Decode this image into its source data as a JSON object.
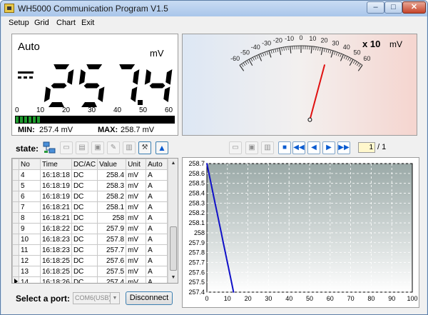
{
  "window": {
    "title": "WH5000 Communication Program V1.5",
    "controls": {
      "minimize": "–",
      "maximize": "□",
      "close": "✕"
    }
  },
  "menu": {
    "items": [
      "Setup",
      "Grid",
      "Chart",
      "Exit"
    ],
    "mnemonics": [
      "S",
      "G",
      "h",
      "E"
    ]
  },
  "display": {
    "mode": "Auto",
    "unit": "mV",
    "reading": "257.4",
    "coupling_icon": "dc-icon",
    "bargraph_ticks": [
      "0",
      "10",
      "20",
      "30",
      "40",
      "50",
      "60"
    ],
    "bargraph_fraction": 0.158,
    "min_label": "MIN:",
    "min_value": "257.4  mV",
    "max_label": "MAX:",
    "max_value": "258.7  mV"
  },
  "gauge": {
    "multiplier": "x 10",
    "unit": "mV",
    "scale_labels": [
      "-60",
      "-50",
      "-40",
      "-30",
      "-20",
      "-10",
      "0",
      "10",
      "20",
      "30",
      "40",
      "50",
      "60"
    ],
    "needle_value": 25.74,
    "needle_color": "#e01010"
  },
  "state": {
    "label": "state:",
    "icons": [
      "network-icon",
      "new-icon",
      "open-icon",
      "save-icon",
      "clear-icon",
      "print-icon",
      "tools-icon",
      "upload-icon"
    ]
  },
  "table": {
    "columns": [
      "No",
      "Time",
      "DC/AC",
      "Value",
      "Unit",
      "Auto"
    ],
    "rows": [
      [
        "4",
        "16:18:18",
        "DC",
        "258.4",
        "mV",
        "A"
      ],
      [
        "5",
        "16:18:19",
        "DC",
        "258.3",
        "mV",
        "A"
      ],
      [
        "6",
        "16:18:19",
        "DC",
        "258.2",
        "mV",
        "A"
      ],
      [
        "7",
        "16:18:21",
        "DC",
        "258.1",
        "mV",
        "A"
      ],
      [
        "8",
        "16:18:21",
        "DC",
        "258",
        "mV",
        "A"
      ],
      [
        "9",
        "16:18:22",
        "DC",
        "257.9",
        "mV",
        "A"
      ],
      [
        "10",
        "16:18:23",
        "DC",
        "257.8",
        "mV",
        "A"
      ],
      [
        "11",
        "16:18:23",
        "DC",
        "257.7",
        "mV",
        "A"
      ],
      [
        "12",
        "16:18:25",
        "DC",
        "257.6",
        "mV",
        "A"
      ],
      [
        "13",
        "16:18:25",
        "DC",
        "257.5",
        "mV",
        "A"
      ],
      [
        "14",
        "16:18:26",
        "DC",
        "257.4",
        "mV",
        "A"
      ]
    ],
    "current_row": 10
  },
  "port": {
    "label": "Select a port:",
    "selected": "COM6(USB)",
    "button_label": "Disconnect"
  },
  "chart_toolbar": {
    "icons": [
      "new-icon",
      "save-icon",
      "print-icon",
      "stop-icon",
      "first-icon",
      "prev-icon",
      "next-icon",
      "last-icon"
    ],
    "page_current": "1",
    "page_total": "/ 1"
  },
  "chart_data": {
    "type": "line",
    "title": "",
    "xlabel": "",
    "ylabel": "",
    "x": [
      0,
      1,
      2,
      3,
      4,
      5,
      6,
      7,
      8,
      9,
      10,
      11,
      12,
      13
    ],
    "series": [
      {
        "values": [
          258.7,
          258.6,
          258.5,
          258.4,
          258.3,
          258.2,
          258.1,
          258.0,
          257.9,
          257.8,
          257.7,
          257.6,
          257.5,
          257.4
        ],
        "color": "#1010c8"
      }
    ],
    "xlim": [
      0,
      100
    ],
    "ylim": [
      257.4,
      258.7
    ],
    "xticks": [
      "0",
      "10",
      "20",
      "30",
      "40",
      "50",
      "60",
      "70",
      "80",
      "90",
      "100"
    ],
    "yticks": [
      "258.7",
      "258.6",
      "258.5",
      "258.4",
      "258.3",
      "258.2",
      "258.1",
      "258",
      "257.9",
      "257.8",
      "257.7",
      "257.6",
      "257.5",
      "257.4"
    ],
    "grid": true
  }
}
